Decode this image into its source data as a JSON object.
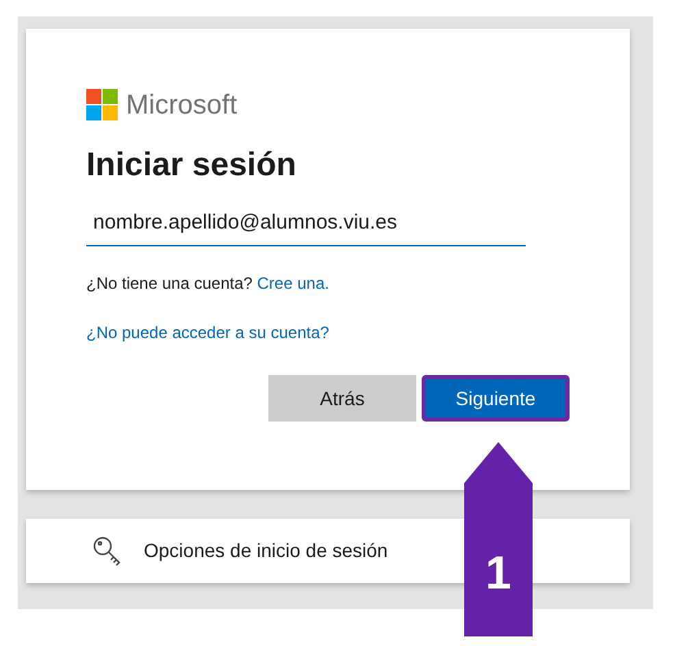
{
  "logo": {
    "text": "Microsoft"
  },
  "title": "Iniciar sesión",
  "email_field": {
    "value": "nombre.apellido@alumnos.viu.es"
  },
  "signup": {
    "text": "¿No tiene una cuenta?",
    "link": "Cree una."
  },
  "recover_link": "¿No puede acceder a su cuenta?",
  "buttons": [
    {
      "label": "Atrás",
      "kind": "secondary",
      "highlighted": false
    },
    {
      "label": "Siguiente",
      "kind": "primary",
      "highlighted": true
    }
  ],
  "options_card": {
    "label": "Opciones de inicio de sesión"
  },
  "callout": {
    "number": "1"
  }
}
